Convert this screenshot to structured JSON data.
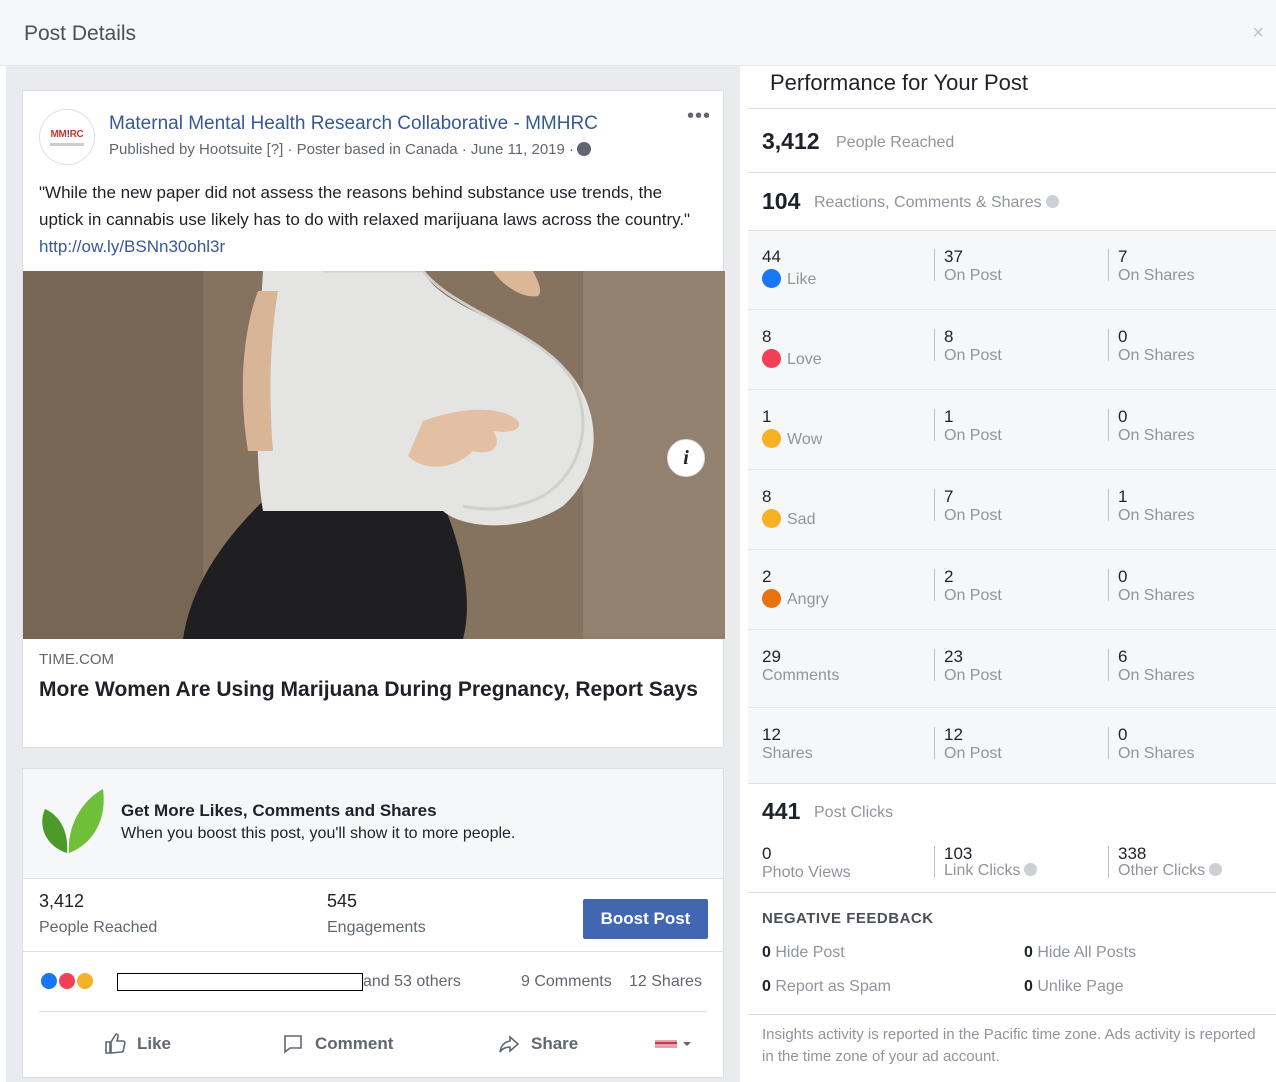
{
  "dialog": {
    "title": "Post Details",
    "close": "×"
  },
  "post": {
    "page_logo_text_left": "MM",
    "page_logo_text_mid": "!",
    "page_logo_text_right": "RC",
    "page_name": "Maternal Mental Health Research Collaborative - MMHRC",
    "meta": "Published by Hootsuite [?] · Poster based in Canada · June 11, 2019 ·",
    "more": "•••",
    "text": "\"While the new paper did not assess the reasons behind substance use trends, the uptick in cannabis use likely has to do with relaxed marijuana laws across the country.\"",
    "link_url": "http://ow.ly/BSNn30ohl3r",
    "image_info": "i",
    "link_source": "TIME.COM",
    "link_title": "More Women Are Using Marijuana During Pregnancy, Report Says"
  },
  "boost": {
    "title": "Get More Likes, Comments and Shares",
    "subtitle": "When you boost this post, you'll show it to more people.",
    "reached_value": "3,412",
    "reached_label": "People Reached",
    "engagements_value": "545",
    "engagements_label": "Engagements",
    "button": "Boost Post"
  },
  "reactions_bar": {
    "others": "and 53 others",
    "comments": "9 Comments",
    "shares": "12 Shares"
  },
  "actions": {
    "like": "Like",
    "comment": "Comment",
    "share": "Share"
  },
  "performance": {
    "title": "Performance for Your Post",
    "reached_value": "3,412",
    "reached_label": "People Reached",
    "engagement_value": "104",
    "engagement_label": "Reactions, Comments & Shares",
    "rows": [
      {
        "total": "44",
        "label": "Like",
        "icon": "like-icon",
        "on_post": "37",
        "on_shares": "7"
      },
      {
        "total": "8",
        "label": "Love",
        "icon": "love-icon",
        "on_post": "8",
        "on_shares": "0"
      },
      {
        "total": "1",
        "label": "Wow",
        "icon": "wow-icon",
        "on_post": "1",
        "on_shares": "0"
      },
      {
        "total": "8",
        "label": "Sad",
        "icon": "sad-icon",
        "on_post": "7",
        "on_shares": "1"
      },
      {
        "total": "2",
        "label": "Angry",
        "icon": "angry-icon",
        "on_post": "2",
        "on_shares": "0"
      },
      {
        "total": "29",
        "label": "Comments",
        "icon": "",
        "on_post": "23",
        "on_shares": "6"
      },
      {
        "total": "12",
        "label": "Shares",
        "icon": "",
        "on_post": "12",
        "on_shares": "0"
      }
    ],
    "on_post_label": "On Post",
    "on_shares_label": "On Shares",
    "clicks_value": "441",
    "clicks_label": "Post Clicks",
    "photo_views_value": "0",
    "photo_views_label": "Photo Views",
    "link_clicks_value": "103",
    "link_clicks_label": "Link Clicks",
    "other_clicks_value": "338",
    "other_clicks_label": "Other Clicks",
    "negative_heading": "NEGATIVE FEEDBACK",
    "negative": [
      {
        "value": "0",
        "label": "Hide Post"
      },
      {
        "value": "0",
        "label": "Hide All Posts"
      },
      {
        "value": "0",
        "label": "Report as Spam"
      },
      {
        "value": "0",
        "label": "Unlike Page"
      }
    ],
    "footnote": "Insights activity is reported in the Pacific time zone. Ads activity is reported in the time zone of your ad account."
  },
  "colors": {
    "facebook_blue": "#4267b2",
    "link_blue": "#365899",
    "like_blue": "#1877f2",
    "love_red": "#f33e58",
    "reaction_yellow": "#f7b125",
    "angry_orange": "#e9710f",
    "leaf_green": "#5fa83a"
  }
}
